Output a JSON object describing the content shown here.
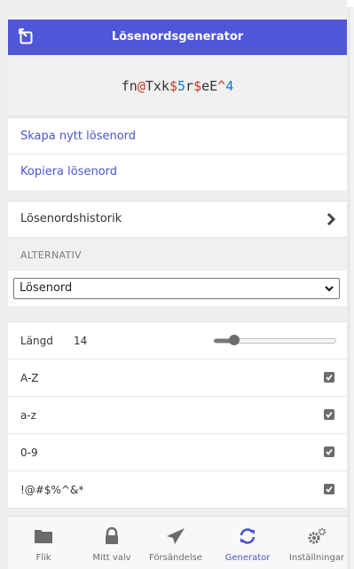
{
  "header": {
    "title": "Lösenordsgenerator",
    "back_icon": "popout-icon"
  },
  "password": {
    "segments": [
      {
        "t": "fn",
        "k": "let"
      },
      {
        "t": "@",
        "k": "sym"
      },
      {
        "t": "Txk",
        "k": "let"
      },
      {
        "t": "$",
        "k": "sym"
      },
      {
        "t": "5",
        "k": "num"
      },
      {
        "t": "r",
        "k": "let"
      },
      {
        "t": "$",
        "k": "sym"
      },
      {
        "t": "eE",
        "k": "let"
      },
      {
        "t": "^",
        "k": "sym"
      },
      {
        "t": "4",
        "k": "num"
      }
    ]
  },
  "actions": {
    "regenerate": "Skapa nytt lösenord",
    "copy": "Kopiera lösenord"
  },
  "history": {
    "label": "Lösenordshistorik"
  },
  "options_section": {
    "heading": "ALTERNATIV"
  },
  "type_select": {
    "value": "Lösenord"
  },
  "length": {
    "label": "Längd",
    "value": "14",
    "slider_fraction": 0.17
  },
  "toggles": [
    {
      "label": "A-Z",
      "checked": true
    },
    {
      "label": "a-z",
      "checked": true
    },
    {
      "label": "0-9",
      "checked": true
    },
    {
      "label": "!@#$%^&*",
      "checked": true
    }
  ],
  "nav": [
    {
      "label": "Flik",
      "icon": "folder-icon",
      "active": false
    },
    {
      "label": "Mitt valv",
      "icon": "lock-icon",
      "active": false
    },
    {
      "label": "Försändelse",
      "icon": "paper-plane-icon",
      "active": false
    },
    {
      "label": "Generator",
      "icon": "refresh-icon",
      "active": true
    },
    {
      "label": "Inställningar",
      "icon": "cogs-icon",
      "active": false
    }
  ],
  "colors": {
    "accent": "#4f56d8",
    "link": "#4a56cc",
    "symbol": "#c83522",
    "number": "#007fde"
  }
}
